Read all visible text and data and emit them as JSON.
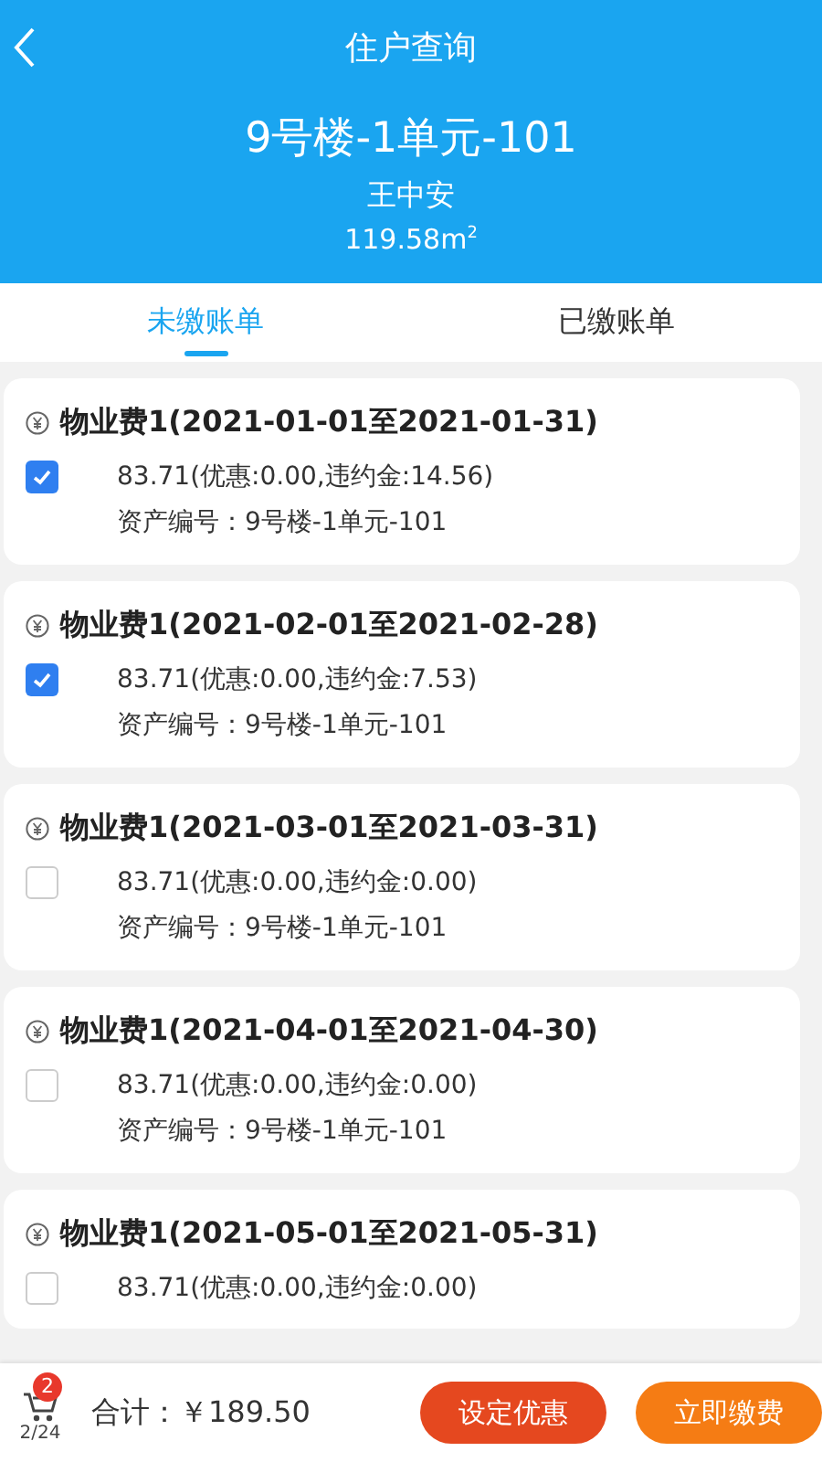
{
  "header": {
    "title": "住户查询",
    "unit": "9号楼-1单元-101",
    "owner": "王中安",
    "area": "119.58m$^{2}$"
  },
  "tabs": [
    {
      "label": "未缴账单",
      "selected": true
    },
    {
      "label": "已缴账单",
      "selected": false
    }
  ],
  "bills": [
    {
      "title": "物业费1(2021-01-01至2021-01-31)",
      "checked": true,
      "amount": "83.71(优惠:0.00,违约金:14.56)",
      "asset": "资产编号：9号楼-1单元-101"
    },
    {
      "title": "物业费1(2021-02-01至2021-02-28)",
      "checked": true,
      "amount": "83.71(优惠:0.00,违约金:7.53)",
      "asset": "资产编号：9号楼-1单元-101"
    },
    {
      "title": "物业费1(2021-03-01至2021-03-31)",
      "checked": false,
      "amount": "83.71(优惠:0.00,违约金:0.00)",
      "asset": "资产编号：9号楼-1单元-101"
    },
    {
      "title": "物业费1(2021-04-01至2021-04-30)",
      "checked": false,
      "amount": "83.71(优惠:0.00,违约金:0.00)",
      "asset": "资产编号：9号楼-1单元-101"
    },
    {
      "title": "物业费1(2021-05-01至2021-05-31)",
      "checked": false,
      "amount": "83.71(优惠:0.00,违约金:0.00)"
    }
  ],
  "footer": {
    "badge": "2",
    "count": "2/24",
    "total": "合计：￥189.50",
    "buttons": [
      {
        "label": "设定优惠",
        "kind": "discount"
      },
      {
        "label": "立即缴费",
        "kind": "pay"
      }
    ]
  }
}
